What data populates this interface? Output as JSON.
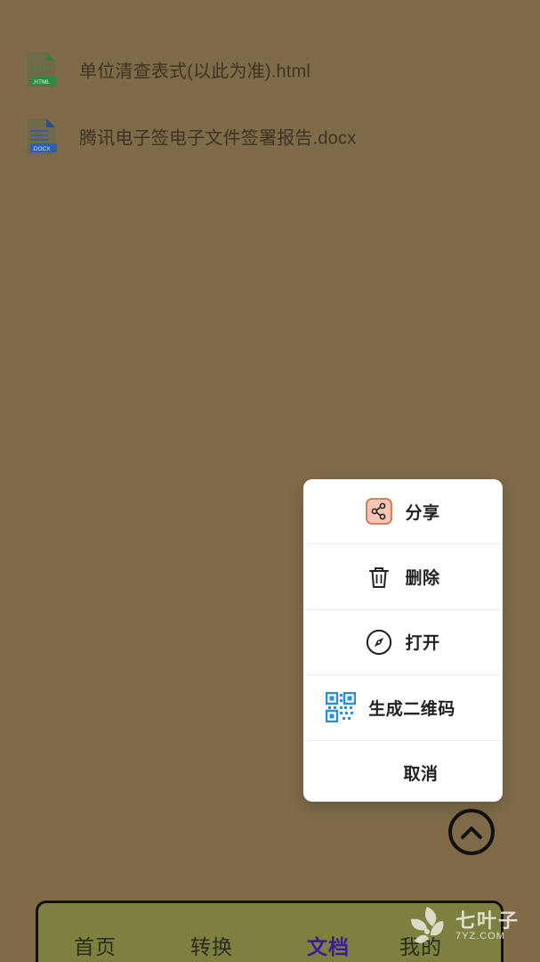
{
  "files": [
    {
      "name": "单位清查表式(以此为准).html",
      "icon": "html-file-icon",
      "badge": ".HTML",
      "badge_color": "#2e9c4a"
    },
    {
      "name": "腾讯电子签电子文件签署报告.docx",
      "icon": "docx-file-icon",
      "badge": ".DOCX",
      "badge_color": "#2f6fd4"
    }
  ],
  "menu": {
    "share": "分享",
    "delete": "删除",
    "open": "打开",
    "qrcode": "生成二维码",
    "cancel": "取消"
  },
  "nav": {
    "home": "首页",
    "convert": "转换",
    "docs": "文档",
    "mine": "我的",
    "active": "文档"
  },
  "watermark": {
    "name": "七叶子",
    "site": "7YZ.COM"
  },
  "colors": {
    "overlay_bg": "#7f6b48",
    "nav_bg": "#7e803f",
    "active_tab": "#3a1b9c",
    "share_icon_bg": "#f8c7b4",
    "qr_blue": "#2a8fd6"
  }
}
